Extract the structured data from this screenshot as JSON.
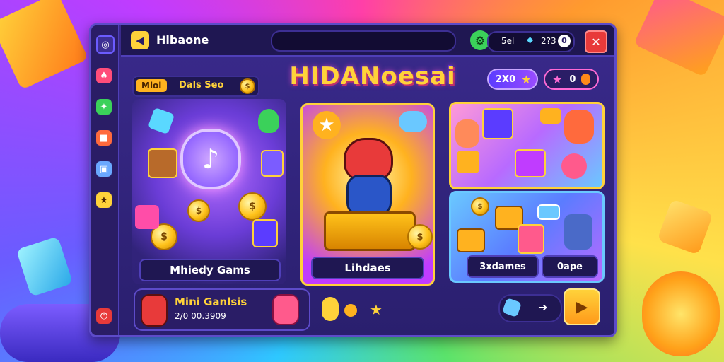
{
  "window": {
    "brand_name": "Hibaone",
    "brand_logo_glyph": "◀"
  },
  "header": {
    "stats_text": "5el",
    "stats_count": "2?3",
    "stats_badge": "0",
    "close_glyph": "✕",
    "settings_glyph": "⚙"
  },
  "main": {
    "title": "HIDANoesai",
    "chip": {
      "tag": "Mlol",
      "text": "Dals Seo"
    },
    "currency": [
      {
        "value": "2X0",
        "icon": "star-icon"
      },
      {
        "value": "0",
        "icon": "star-icon"
      }
    ],
    "panels": [
      {
        "label": "Mhiedy Gams"
      },
      {
        "label": "Lihdaes"
      },
      {
        "label": "3xdames"
      },
      {
        "label": "0ape"
      }
    ]
  },
  "footer": {
    "promo_title": "Mini Ganlsis",
    "promo_sub": "2/0 00.3909",
    "play_glyph": "▶",
    "arrow_glyph": "➜"
  },
  "colors": {
    "window_bg": "#3a2a8c",
    "accent_gold": "#ffd23a",
    "close_red": "#e83a3a",
    "gear_green": "#3bd15a"
  }
}
